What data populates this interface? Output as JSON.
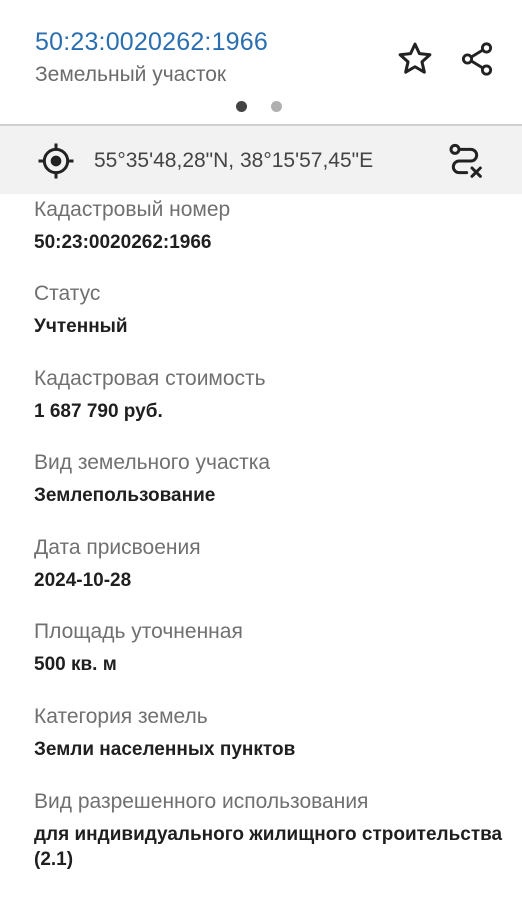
{
  "header": {
    "title": "50:23:0020262:1966",
    "subtitle": "Земельный участок",
    "favorite_icon": "star-outline-icon",
    "share_icon": "share-icon",
    "pager": {
      "count": 2,
      "active": 0,
      "active_color": "#444444",
      "inactive_color": "#b0b0b0"
    }
  },
  "coords_bar": {
    "locate_icon": "crosshair-target-icon",
    "coordinates": "55°35'48,28\"N, 38°15'57,45\"E",
    "route_icon": "route-cancel-icon"
  },
  "fields": [
    {
      "label": "Кадастровый номер",
      "value": "50:23:0020262:1966"
    },
    {
      "label": "Статус",
      "value": "Учтенный"
    },
    {
      "label": "Кадастровая стоимость",
      "value": "1 687 790 руб."
    },
    {
      "label": "Вид земельного участка",
      "value": "Землепользование"
    },
    {
      "label": "Дата присвоения",
      "value": "2024-10-28"
    },
    {
      "label": "Площадь уточненная",
      "value": "500 кв. м"
    },
    {
      "label": "Категория земель",
      "value": "Земли населенных пунктов"
    },
    {
      "label": "Вид разрешенного использования",
      "value": "для индивидуального жилищного строительства (2.1)"
    }
  ],
  "colors": {
    "title": "#2a6fb0",
    "label": "#707070",
    "value": "#1f1f1f",
    "bar_bg": "#f2f2f2"
  }
}
